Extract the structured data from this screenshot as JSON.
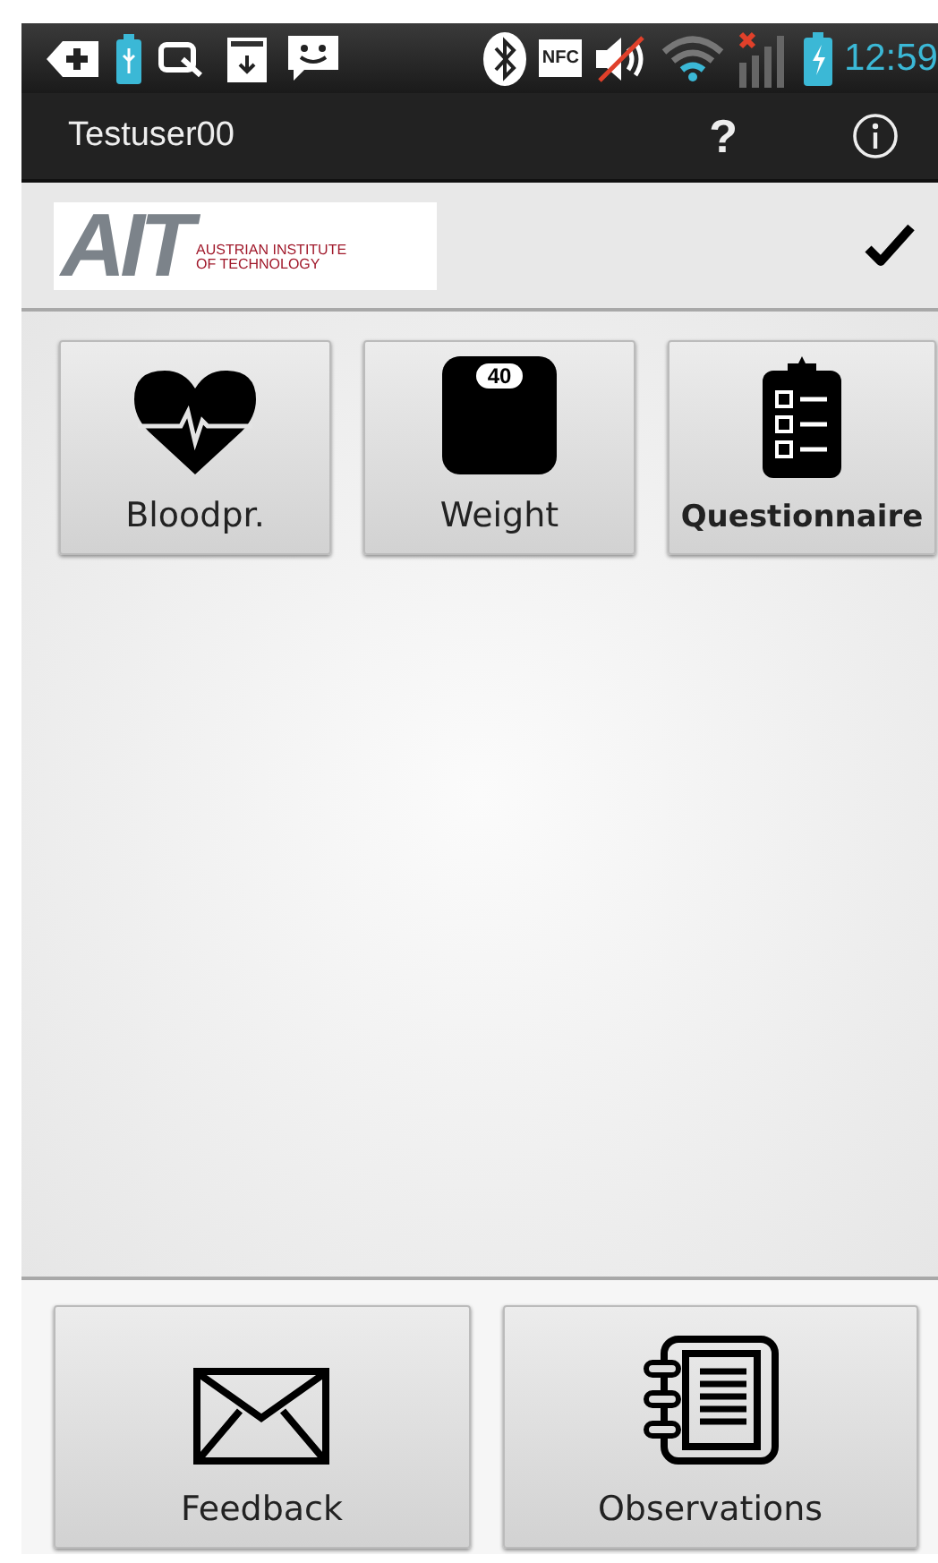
{
  "status_bar": {
    "nfc": "NFC",
    "time": "12:59"
  },
  "action_bar": {
    "title": "Testuser00",
    "help": "?"
  },
  "logo": {
    "letters": "AIT",
    "line_1": "AUSTRIAN INSTITUTE",
    "line_2": "OF TECHNOLOGY"
  },
  "tiles": [
    {
      "label": "Bloodpr."
    },
    {
      "label": "Weight",
      "icon_text": "40"
    },
    {
      "label": "Questionnaire"
    }
  ],
  "bottom_buttons": [
    {
      "label": "Feedback"
    },
    {
      "label": "Observations"
    }
  ]
}
